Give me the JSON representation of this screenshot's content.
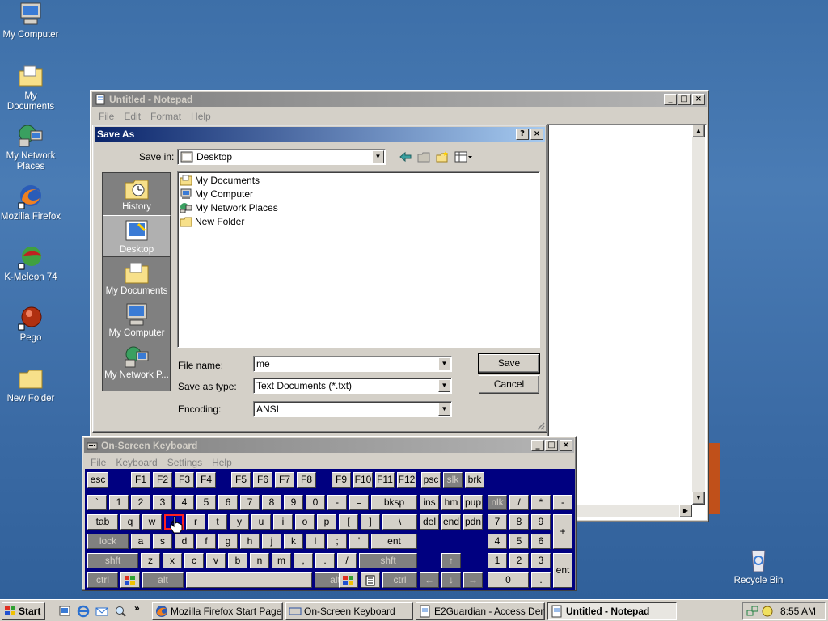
{
  "desktop": {
    "icons": [
      {
        "label": "My Computer"
      },
      {
        "label": "My Documents"
      },
      {
        "label": "My Network Places"
      },
      {
        "label": "Mozilla Firefox"
      },
      {
        "label": "K-Meleon 74"
      },
      {
        "label": "Pego"
      },
      {
        "label": "New Folder"
      },
      {
        "label": "Recycle Bin"
      }
    ]
  },
  "notepad": {
    "title": "Untitled - Notepad",
    "menu": [
      "File",
      "Edit",
      "Format",
      "Help"
    ]
  },
  "save_dialog": {
    "title": "Save As",
    "help_btn": "?",
    "close_btn": "×",
    "save_in_label": "Save in:",
    "save_in_value": "Desktop",
    "places": [
      "History",
      "Desktop",
      "My Documents",
      "My Computer",
      "My Network P..."
    ],
    "files": [
      "My Documents",
      "My Computer",
      "My Network Places",
      "New Folder"
    ],
    "file_name_label": "File name:",
    "file_name_value": "me",
    "save_type_label": "Save as type:",
    "save_type_value": "Text Documents (*.txt)",
    "encoding_label": "Encoding:",
    "encoding_value": "ANSI",
    "save_button": "Save",
    "cancel_button": "Cancel"
  },
  "osk": {
    "title": "On-Screen Keyboard",
    "menu": [
      "File",
      "Keyboard",
      "Settings",
      "Help"
    ],
    "pressed_key": "e"
  },
  "taskbar": {
    "start": "Start",
    "tasks": [
      {
        "label": "Mozilla Firefox Start Page -...",
        "active": false
      },
      {
        "label": "On-Screen Keyboard",
        "active": false
      },
      {
        "label": "E2Guardian - Access Deni...",
        "active": false
      },
      {
        "label": "Untitled - Notepad",
        "active": true
      }
    ],
    "clock": "8:55 AM"
  },
  "colors": {
    "desktop": "#3d6fa8",
    "active_title": "#0a246a",
    "keyboard_bg": "#000080",
    "face": "#d4d0c8"
  }
}
